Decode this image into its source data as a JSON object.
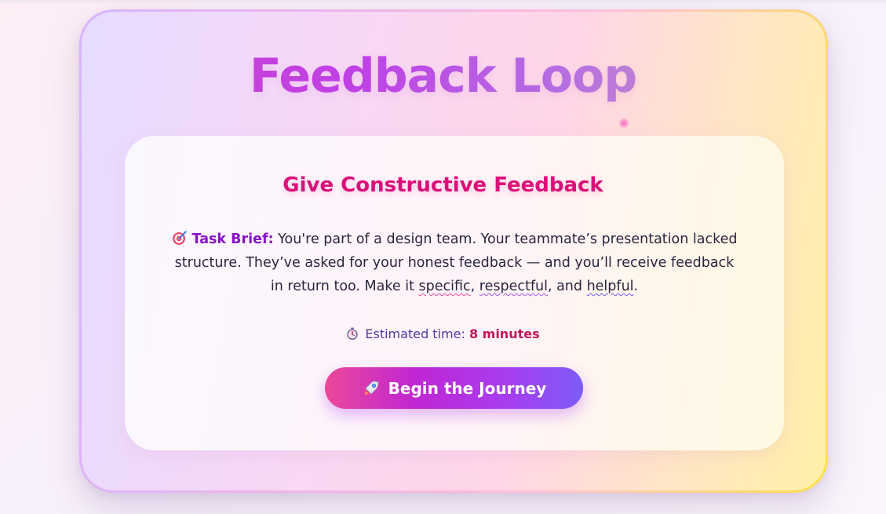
{
  "header": {
    "title": "Feedback Loop"
  },
  "card": {
    "heading": "Give Constructive Feedback",
    "brief": {
      "icon": "target-icon",
      "label": "Task Brief:",
      "text_before": " You're part of a design team. Your teammate’s presentation lacked structure. They’ve asked for your honest feedback — and you’ll receive feedback in return too. Make it ",
      "word_specific": "specific",
      "sep1": ", ",
      "word_respectful": "respectful",
      "sep2": ", and ",
      "word_helpful": "helpful",
      "end": "."
    },
    "time": {
      "icon": "stopwatch-icon",
      "label": "Estimated time: ",
      "value": "8 minutes"
    },
    "cta": {
      "icon": "rocket-icon",
      "label": "Begin the Journey"
    }
  },
  "colors": {
    "accent_pink": "#db0f7a",
    "accent_purple": "#8a12c9",
    "time_label": "#4c3aa8",
    "time_value": "#c2185b",
    "button_gradient_start": "#ec4899",
    "button_gradient_end": "#7c5cf6"
  }
}
